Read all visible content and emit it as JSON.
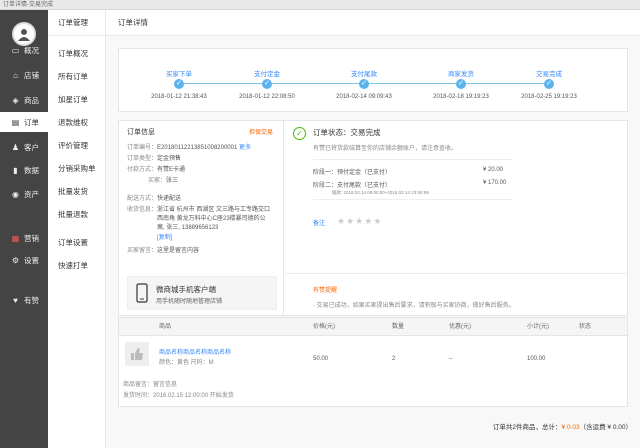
{
  "window_title": "订单详情-交易完成",
  "sidebar": {
    "items": [
      {
        "label": "概况",
        "icon": "monitor-icon"
      },
      {
        "label": "店铺",
        "icon": "store-icon"
      },
      {
        "label": "商品",
        "icon": "tag-icon"
      },
      {
        "label": "订单",
        "icon": "order-icon"
      },
      {
        "label": "客户",
        "icon": "user-icon"
      },
      {
        "label": "数据",
        "icon": "chart-icon"
      },
      {
        "label": "资产",
        "icon": "money-icon"
      },
      {
        "label": "营销",
        "icon": "apps-icon"
      },
      {
        "label": "设置",
        "icon": "gear-icon"
      },
      {
        "label": "有赞",
        "icon": "thumb-icon"
      }
    ]
  },
  "subnav": {
    "title": "订单管理",
    "items": [
      "订单概况",
      "所有订单",
      "加星订单",
      "退款维权",
      "评价管理",
      "分销采购单",
      "批量发货",
      "批量退款",
      "订单设置",
      "快速打单"
    ]
  },
  "page": {
    "title": "订单详情"
  },
  "steps": [
    {
      "label": "买家下单",
      "time": "2018-01-12 21:38:43"
    },
    {
      "label": "支付定金",
      "time": "2018-01-12 22:08:50"
    },
    {
      "label": "支付尾款",
      "time": "2018-02-14 09:09:43"
    },
    {
      "label": "商家发货",
      "time": "2018-02-18 19:19:23"
    },
    {
      "label": "交易完成",
      "time": "2018-02-25 19:19:23"
    }
  ],
  "order_info": {
    "title": "订单信息",
    "action": "担保交易",
    "number_label": "订单编号：",
    "number": "E20180112213851008200001",
    "more": "更多",
    "type_label": "订单类型：",
    "type": "定金预售",
    "pay_label": "付款方式：",
    "pay": "有赞E卡通",
    "buyer_label": "买家：",
    "buyer": "张三",
    "delivery_label": "配送方式：",
    "delivery": "快递配送",
    "receiver_label": "收货信息：",
    "address1": "浙江省 杭州市 西湖区 文三路与工专路交口",
    "address2": "西南角 黄龙万科中心C座23楼暴司德的公",
    "address3": "寓, 张三, 13889656123",
    "copy": "[复制]",
    "message_label": "买家留言：",
    "message": "这里是留言内容",
    "mobile_title": "微商城手机客户端",
    "mobile_sub": "用手机随时随地管理店铺"
  },
  "status": {
    "title": "订单状态：交易完成",
    "desc": "有赞已将货款结算至你的店铺余额账户，请注意查收。",
    "stage1_label": "阶段一：预付定金（已支付）",
    "stage1_amount": "¥ 20.00",
    "stage2_label": "阶段二：支付尾款（已支付）",
    "stage2_amount": "¥ 170.00",
    "stage2_time": "尾款: 2018.02.14 09:00:00~2018.02.14 23:59:59",
    "remark_label": "备注",
    "tip_title": "有赞提醒",
    "tip_text": "· 交易已成功，如果买家提出售后要求，请积极与买家协商，做好售后服务。"
  },
  "table": {
    "headers": [
      "商品",
      "价格(元)",
      "数量",
      "优惠(元)",
      "小计(元)",
      "状态"
    ],
    "product_name": "商品名称商品名称商品名称",
    "product_spec": "颜色：黄色  尺码：M",
    "price": "50.00",
    "qty": "2",
    "discount": "–",
    "subtotal": "100.00",
    "note_label": "商品留言：",
    "note": "留言信息",
    "ship_label": "发货时间：",
    "ship": "2016.02.15 12:00:00 开始发货"
  },
  "footer": {
    "prefix": "订单共2件商品，总计：",
    "total": "¥ 0.03",
    "suffix": "（含运费 ¥ 0.00）"
  }
}
